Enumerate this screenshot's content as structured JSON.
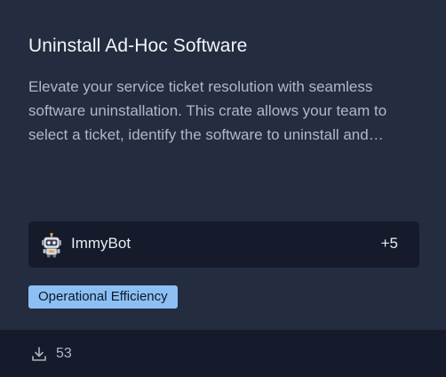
{
  "card": {
    "title": "Uninstall Ad-Hoc Software",
    "description": "Elevate your service ticket resolution with seamless software uninstallation. This crate allows your team to select a ticket, identify the software to uninstall and resolve the request quickly.",
    "author": {
      "name": "ImmyBot",
      "avatar_icon": "robot-icon",
      "more_count": "+5"
    },
    "tag": "Operational Efficiency",
    "footer": {
      "download_icon": "download-icon",
      "download_count": "53"
    }
  },
  "colors": {
    "card_background": "#232d3f",
    "panel_background": "#151b2b",
    "tag_background": "#8cc0f4",
    "title_text": "#f3f5f9",
    "muted_text": "#b0b8c6"
  }
}
